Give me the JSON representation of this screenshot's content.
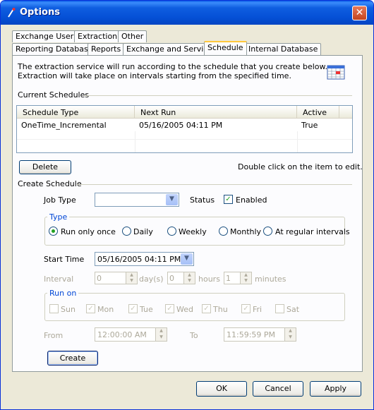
{
  "window": {
    "title": "Options",
    "close_symbol": "✕"
  },
  "tabs_row1": [
    "Exchange Users",
    "Extraction",
    "Other"
  ],
  "tabs_row2": [
    "Reporting Database",
    "Reports",
    "Exchange and Service",
    "Schedule",
    "Internal Database"
  ],
  "intro": {
    "line1": "The extraction service will run according to the schedule that you create below.",
    "line2": "Extraction will take place on intervals starting from the specified time."
  },
  "current": {
    "title": "Current Schedules",
    "columns": [
      "Schedule Type",
      "Next Run",
      "Active"
    ],
    "rows": [
      {
        "type": "OneTime_Incremental",
        "next_run": "05/16/2005 04:11 PM",
        "active": "True"
      }
    ]
  },
  "delete_label": "Delete",
  "hint": "Double click on the item to edit.",
  "create": {
    "title": "Create Schedule",
    "job_type_label": "Job Type",
    "job_type_value": "",
    "status_label": "Status",
    "enabled_label": "Enabled",
    "enabled": true,
    "type_group": "Type",
    "type_options": [
      "Run only once",
      "Daily",
      "Weekly",
      "Monthly",
      "At regular intervals"
    ],
    "type_selected": "Run only once",
    "start_time_label": "Start Time",
    "start_time_value": "05/16/2005   04:11 PM",
    "interval_label": "Interval",
    "day_value": "0",
    "day_unit": "day(s)",
    "hour_value": "0",
    "hour_unit": "hours",
    "minute_value": "1",
    "minute_unit": "minutes",
    "run_on_label": "Run on",
    "days": [
      "Sun",
      "Mon",
      "Tue",
      "Wed",
      "Thu",
      "Fri",
      "Sat"
    ],
    "days_checked": [
      false,
      true,
      true,
      true,
      true,
      true,
      false
    ],
    "from_label": "From",
    "from_value": "12:00:00 AM",
    "to_label": "To",
    "to_value": "11:59:59 PM",
    "create_label": "Create"
  },
  "buttons": {
    "ok": "OK",
    "cancel": "Cancel",
    "apply": "Apply"
  }
}
